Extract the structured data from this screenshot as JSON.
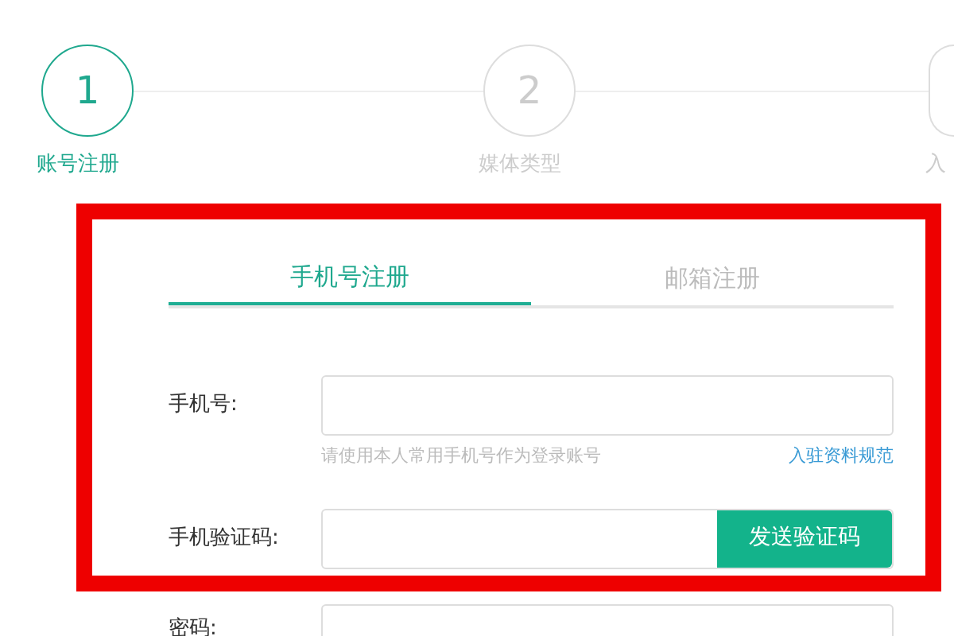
{
  "steps": [
    {
      "number": "1",
      "label": "账号注册",
      "selected": true
    },
    {
      "number": "2",
      "label": "媒体类型",
      "selected": false
    },
    {
      "label": "入",
      "selected": false
    }
  ],
  "tabs": [
    {
      "label": "手机号注册",
      "selected": true
    },
    {
      "label": "邮箱注册",
      "selected": false
    }
  ],
  "form": {
    "phone": {
      "label": "手机号:",
      "hint": "请使用本人常用手机号作为登录账号",
      "link": "入驻资料规范"
    },
    "code": {
      "label": "手机验证码:",
      "button": "发送验证码"
    },
    "password": {
      "label": "密码:"
    }
  }
}
